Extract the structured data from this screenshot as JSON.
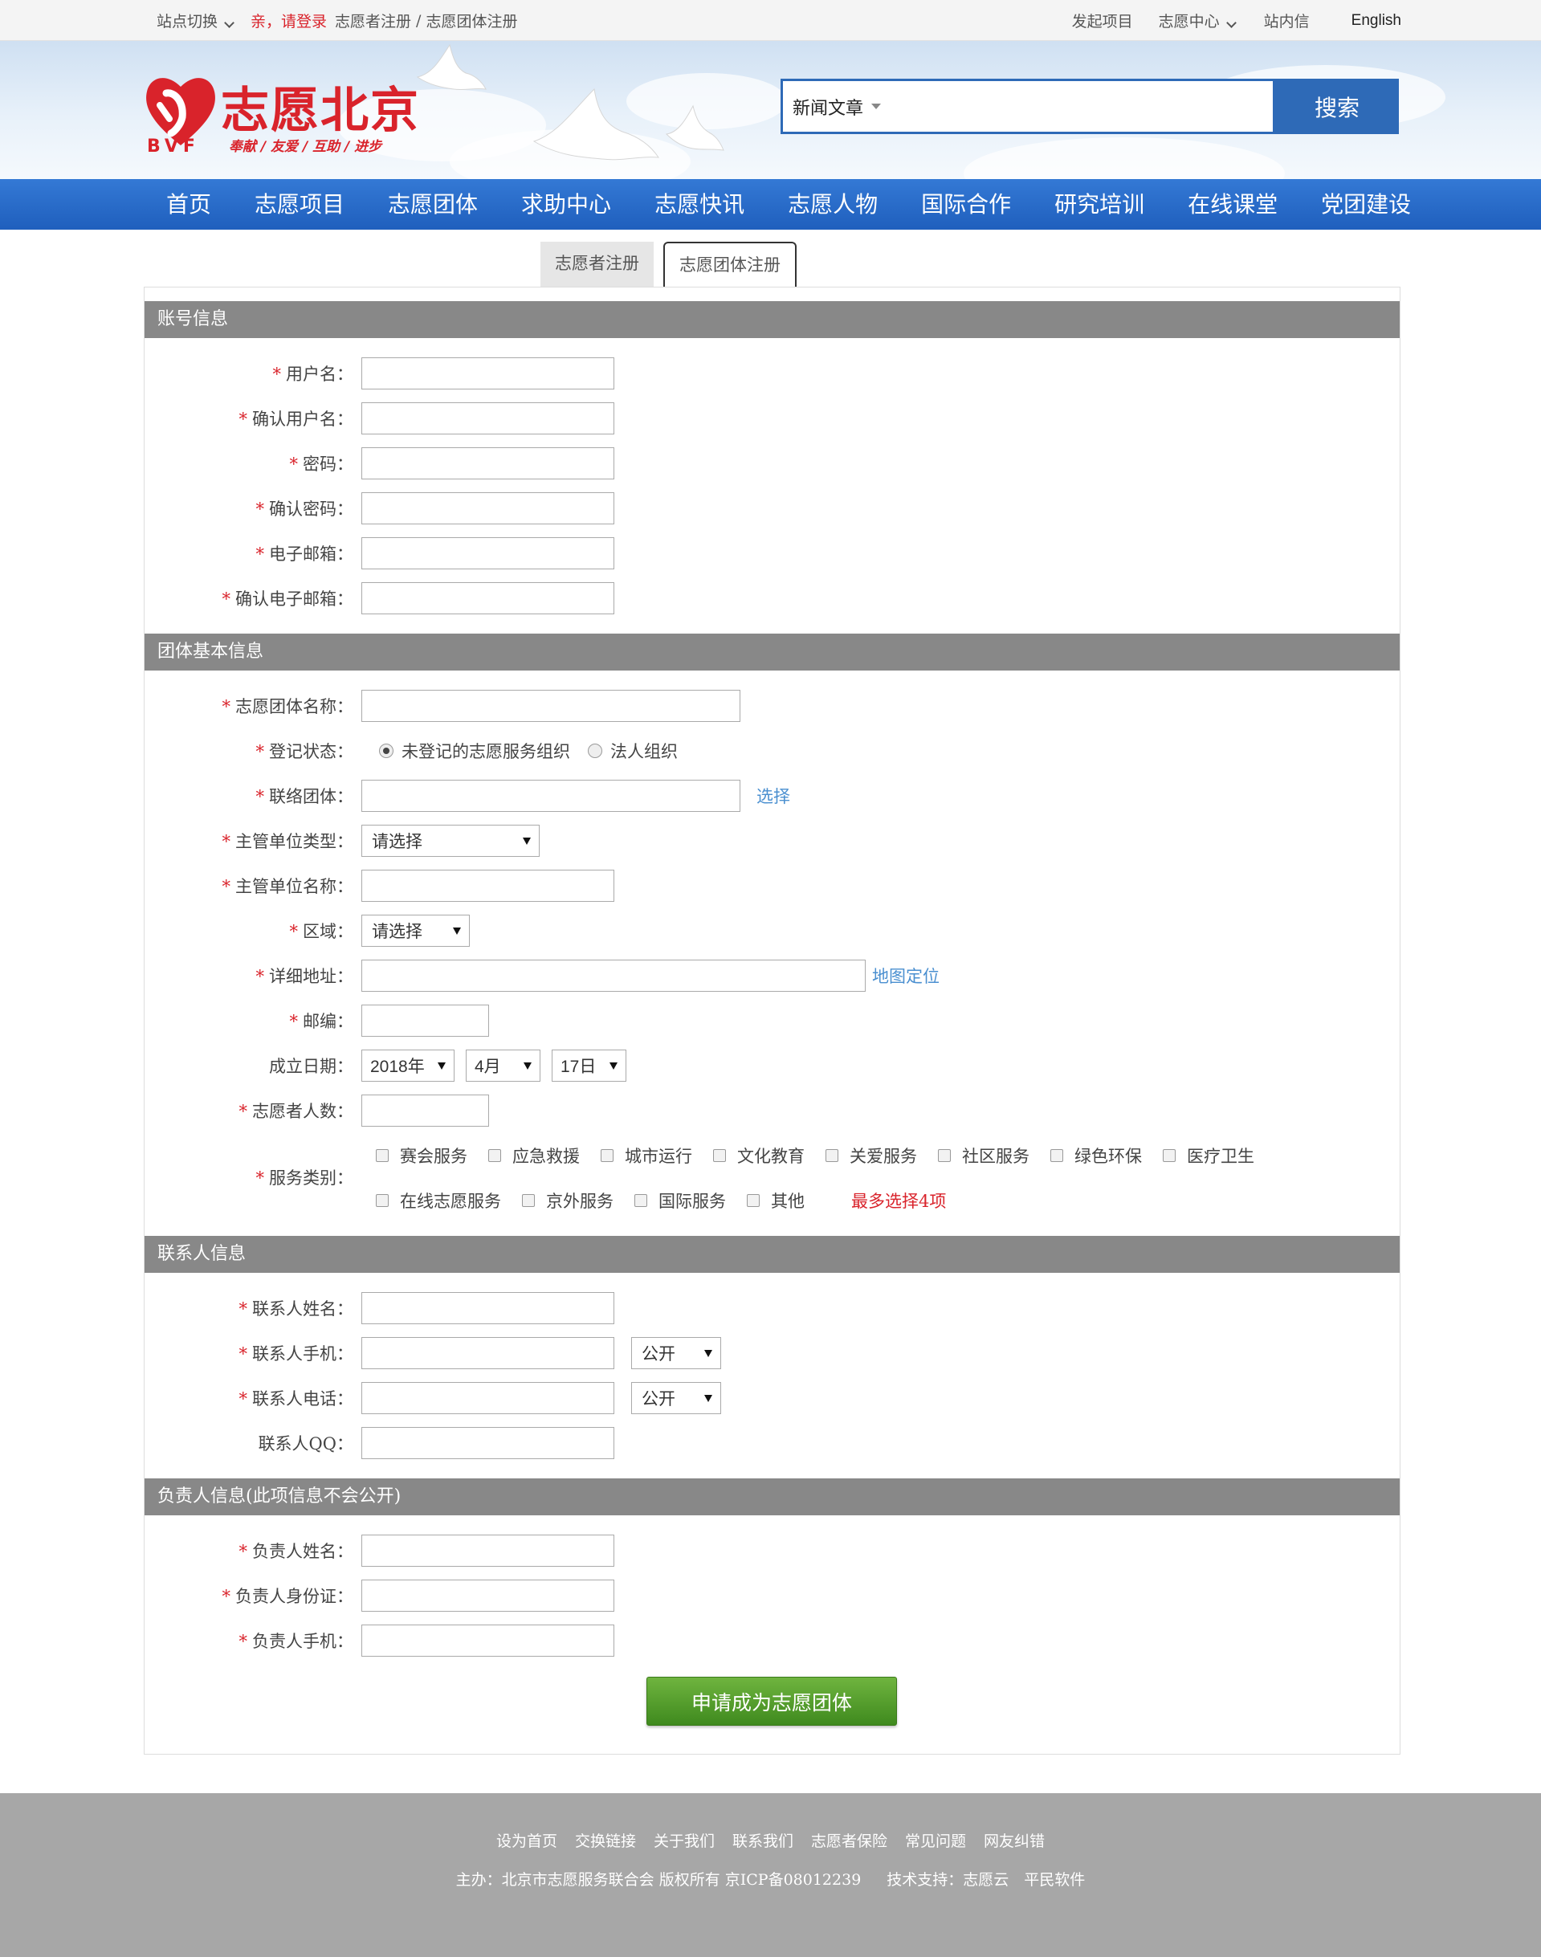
{
  "topbar": {
    "site_switch": "站点切换",
    "login_prompt": "亲，请登录",
    "volunteer_register": "志愿者注册",
    "separator": "/",
    "group_register": "志愿团体注册",
    "launch_project": "发起项目",
    "volunteer_center": "志愿中心",
    "messages": "站内信",
    "english": "English"
  },
  "header": {
    "logo_title": "志愿北京",
    "logo_abbr": "BVF",
    "logo_slogan": "奉献 / 友爱 / 互助 / 进步",
    "search_category": "新闻文章",
    "search_button": "搜索"
  },
  "nav": {
    "items": [
      "首页",
      "志愿项目",
      "志愿团体",
      "求助中心",
      "志愿快讯",
      "志愿人物",
      "国际合作",
      "研究培训",
      "在线课堂",
      "党团建设"
    ]
  },
  "tabs": {
    "volunteer": "志愿者注册",
    "group": "志愿团体注册"
  },
  "form": {
    "account": {
      "title": "账号信息",
      "username": "用户名：",
      "confirm_username": "确认用户名：",
      "password": "密码：",
      "confirm_password": "确认密码：",
      "email": "电子邮箱：",
      "confirm_email": "确认电子邮箱："
    },
    "basic": {
      "title": "团体基本信息",
      "group_name": "志愿团体名称：",
      "reg_status": "登记状态：",
      "reg_option1": "未登记的志愿服务组织",
      "reg_option2": "法人组织",
      "liaison_group": "联络团体：",
      "select_link": "选择",
      "supervisor_type": "主管单位类型：",
      "supervisor_type_value": "请选择",
      "supervisor_name": "主管单位名称：",
      "region": "区域：",
      "region_value": "请选择",
      "address": "详细地址：",
      "map_link": "地图定位",
      "postcode": "邮编：",
      "founded_date": "成立日期：",
      "year": "2018年",
      "month": "4月",
      "day": "17日",
      "volunteer_count": "志愿者人数：",
      "service_type": "服务类别：",
      "service_options_row1": [
        "赛会服务",
        "应急救援",
        "城市运行",
        "文化教育",
        "关爱服务",
        "社区服务",
        "绿色环保",
        "医疗卫生"
      ],
      "service_options_row2": [
        "在线志愿服务",
        "京外服务",
        "国际服务",
        "其他"
      ],
      "service_hint": "最多选择4项"
    },
    "contact": {
      "title": "联系人信息",
      "name": "联系人姓名：",
      "mobile": "联系人手机：",
      "mobile_visibility": "公开",
      "phone": "联系人电话：",
      "phone_visibility": "公开",
      "qq": "联系人QQ："
    },
    "responsible": {
      "title": "负责人信息(此项信息不会公开)",
      "name": "负责人姓名：",
      "id_card": "负责人身份证：",
      "mobile": "负责人手机："
    },
    "submit": "申请成为志愿团体"
  },
  "footer": {
    "links": [
      "设为首页",
      "交换链接",
      "关于我们",
      "联系我们",
      "志愿者保险",
      "常见问题",
      "网友纠错"
    ],
    "copyright": "主办：北京市志愿服务联合会 版权所有 京ICP备08012239",
    "tech_support": "技术支持：志愿云　平民软件"
  },
  "colors": {
    "brand_red": "#d9232b",
    "nav_blue": "#1f5fbd",
    "section_gray": "#888888",
    "submit_green": "#4f9a2a",
    "footer_gray": "#a7a7a7"
  }
}
